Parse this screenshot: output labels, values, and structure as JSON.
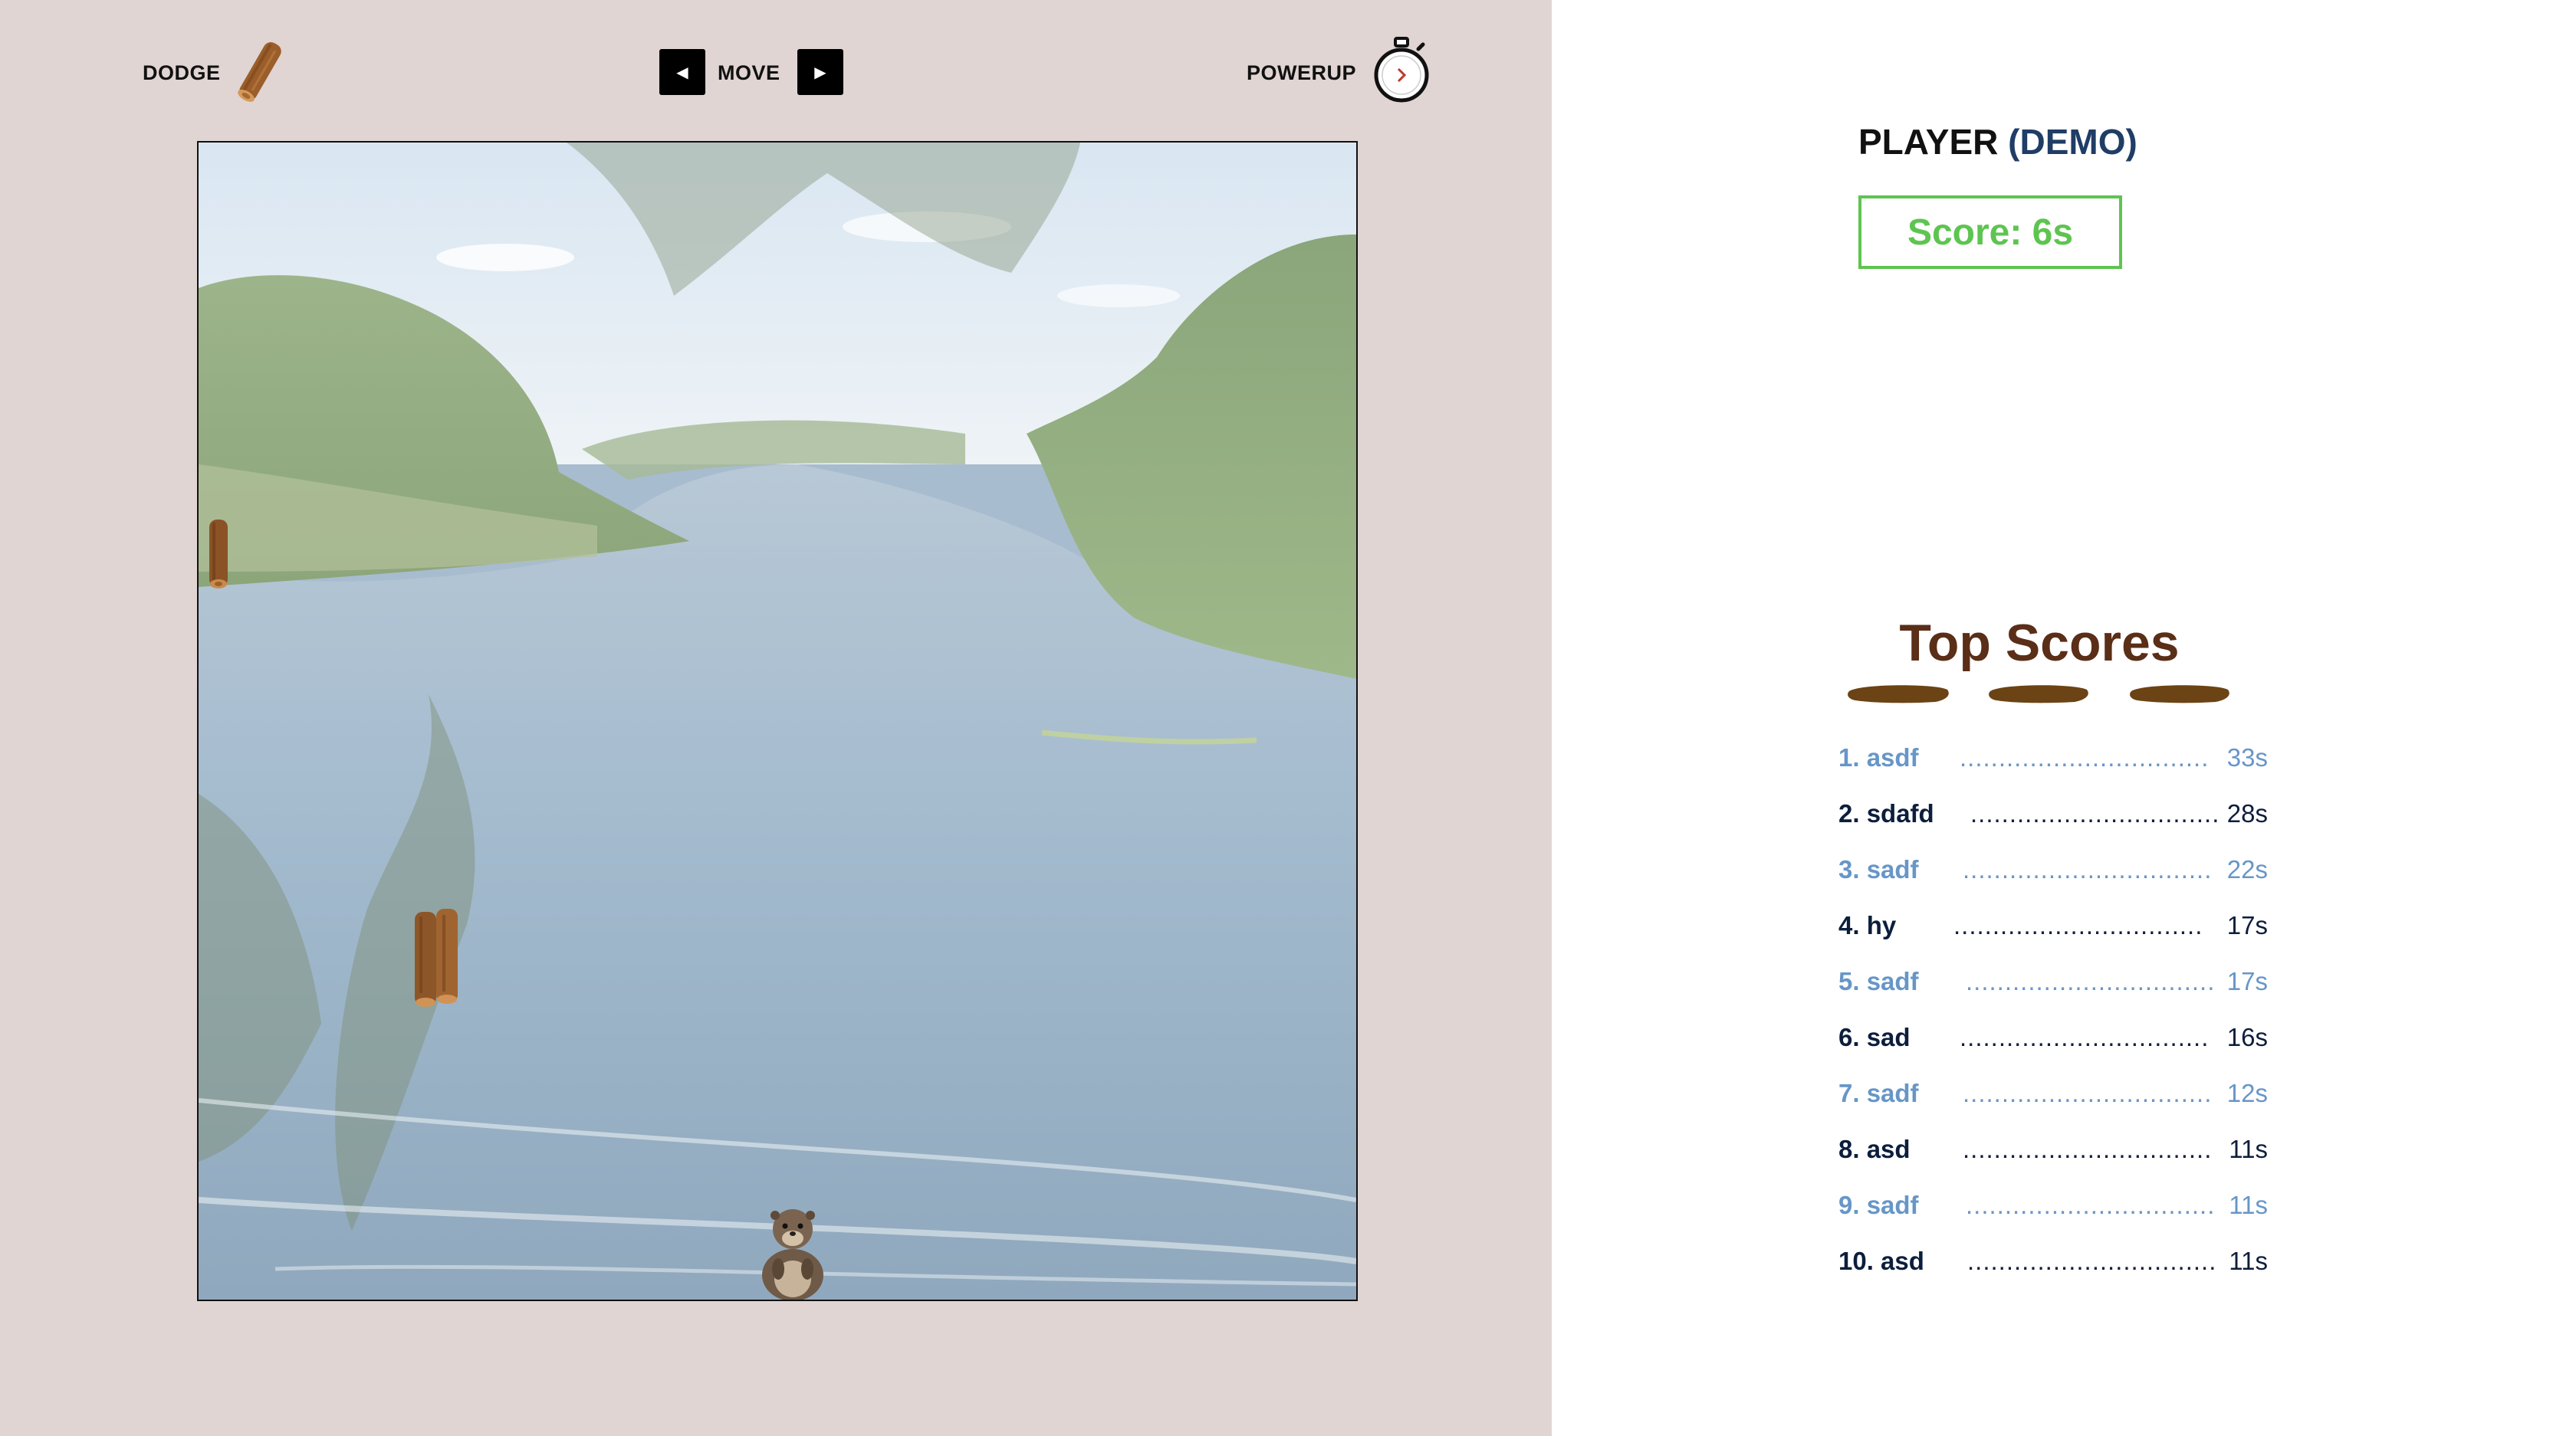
{
  "hud": {
    "dodge_label": "DODGE",
    "move_label": "MOVE",
    "powerup_label": "POWERUP",
    "left_arrow": "◀",
    "right_arrow": "▶",
    "dodge_icon": "log-icon",
    "powerup_icon": "stopwatch-icon"
  },
  "player": {
    "label": "PLAYER",
    "name": "(DEMO)",
    "score_text": "Score: 6s"
  },
  "leaderboard": {
    "title": "Top Scores",
    "rows": [
      {
        "rank_name": "1. asdf",
        "dots": "................................",
        "score": "33s"
      },
      {
        "rank_name": "2. sdafd",
        "dots": "................................",
        "score": "28s"
      },
      {
        "rank_name": "3. sadf",
        "dots": "................................",
        "score": "22s"
      },
      {
        "rank_name": "4. hy",
        "dots": "................................",
        "score": "17s"
      },
      {
        "rank_name": "5. sadf",
        "dots": "................................",
        "score": "17s"
      },
      {
        "rank_name": "6. sad",
        "dots": "................................",
        "score": "16s"
      },
      {
        "rank_name": "7. sadf",
        "dots": "................................",
        "score": "12s"
      },
      {
        "rank_name": "8. asd",
        "dots": "................................",
        "score": "11s"
      },
      {
        "rank_name": "9. sadf",
        "dots": "................................",
        "score": "11s"
      },
      {
        "rank_name": "10. asd",
        "dots": "................................",
        "score": "11s"
      }
    ]
  },
  "colors": {
    "left_bg": "#e0d5d2",
    "score_green": "#5ec451",
    "top_scores_brown": "#5a2e17",
    "row_light": "#6796c8",
    "row_dark": "#0c1e3c"
  }
}
